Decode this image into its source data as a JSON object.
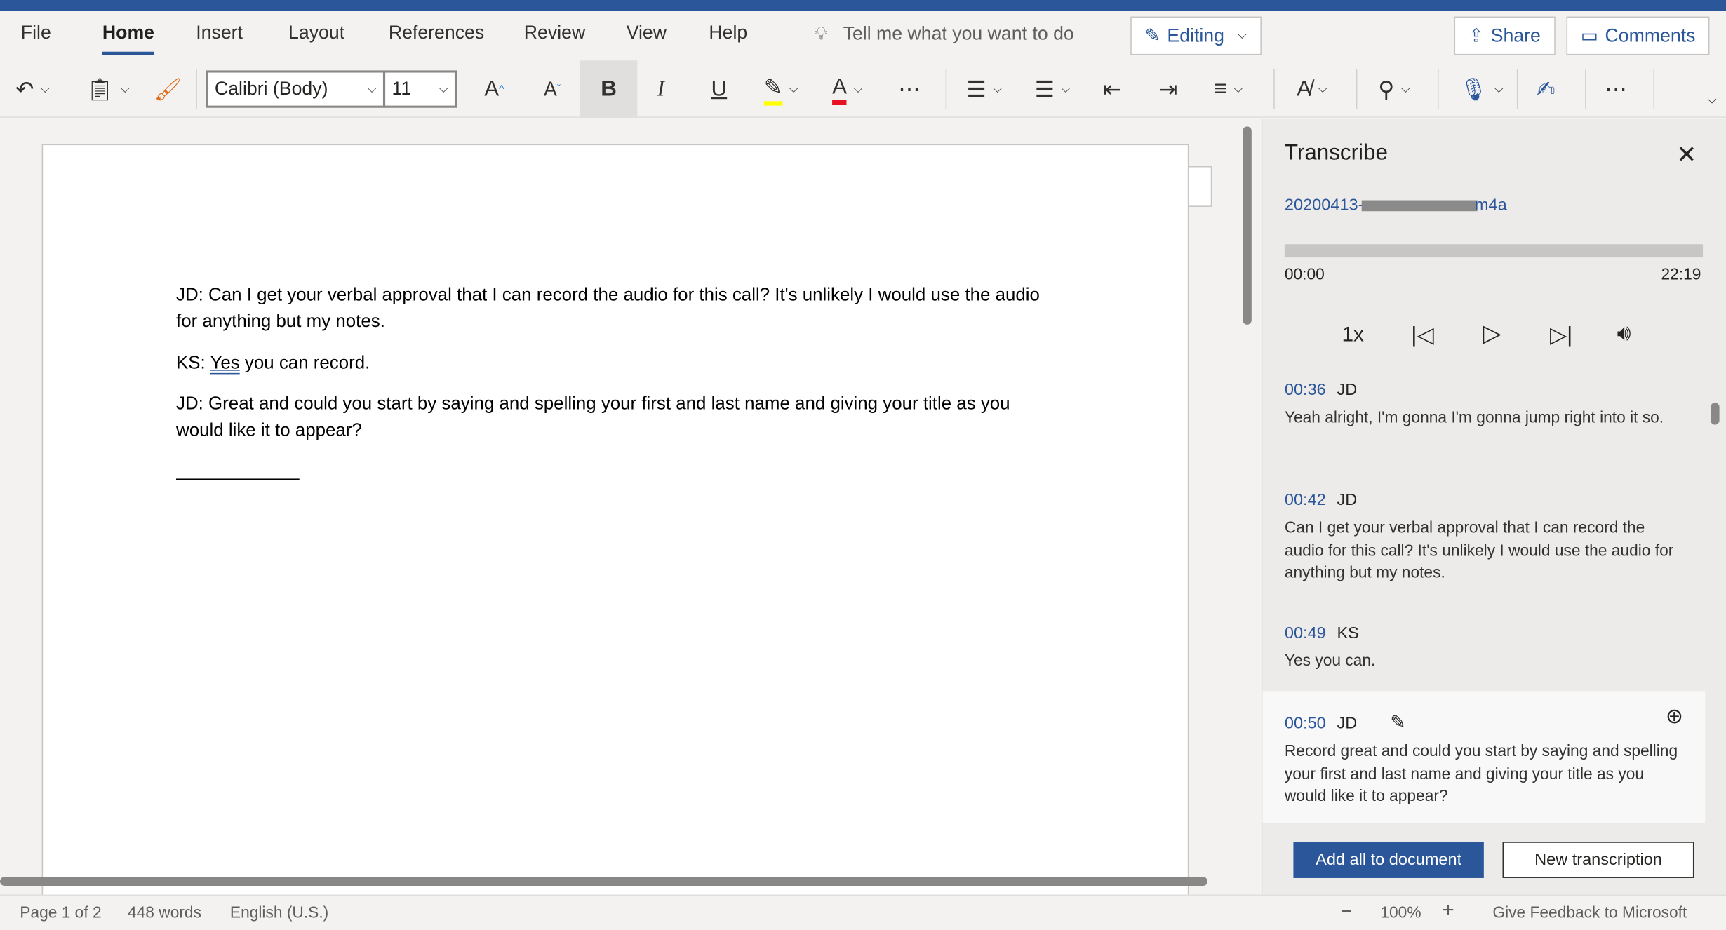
{
  "ribbon": {
    "tabs": [
      "File",
      "Home",
      "Insert",
      "Layout",
      "References",
      "Review",
      "View",
      "Help"
    ],
    "active_tab": "Home",
    "tell_me": "Tell me what you want to do",
    "editing": "Editing",
    "share": "Share",
    "comments": "Comments"
  },
  "toolbar": {
    "font": "Calibri (Body)",
    "size": "11",
    "highlight_color": "#ffff00",
    "font_color": "#e81123"
  },
  "document": {
    "paragraphs": [
      "JD: Can I get your verbal approval that I can record the audio for this call? It's unlikely I would use the audio for anything but my notes.",
      "you can record.",
      "JD: Great and could you start by saying and spelling your first and last name and giving your title as you would like it to appear?"
    ],
    "ks_prefix": "KS: ",
    "ks_yes": "Yes"
  },
  "transcribe": {
    "title": "Transcribe",
    "file_prefix": "20200413-",
    "file_suffix": "m4a",
    "time_start": "00:00",
    "time_end": "22:19",
    "speed": "1x",
    "progress": 0,
    "entries": [
      {
        "time": "00:36",
        "speaker": "JD",
        "text": "Yeah alright, I'm gonna I'm gonna jump right into it so."
      },
      {
        "time": "00:42",
        "speaker": "JD",
        "text": "Can I get your verbal approval that I can record the audio for this call? It's unlikely I would use the audio for anything but my notes."
      },
      {
        "time": "00:49",
        "speaker": "KS",
        "text": "Yes you can."
      },
      {
        "time": "00:50",
        "speaker": "JD",
        "text": "Record great and could you start by saying and spelling your first and last name and giving your title as you would like it to appear?"
      }
    ],
    "add_all": "Add all to document",
    "new_transcription": "New transcription"
  },
  "status": {
    "page": "Page 1 of 2",
    "words": "448 words",
    "language": "English (U.S.)",
    "zoom": "100%",
    "feedback": "Give Feedback to Microsoft"
  }
}
